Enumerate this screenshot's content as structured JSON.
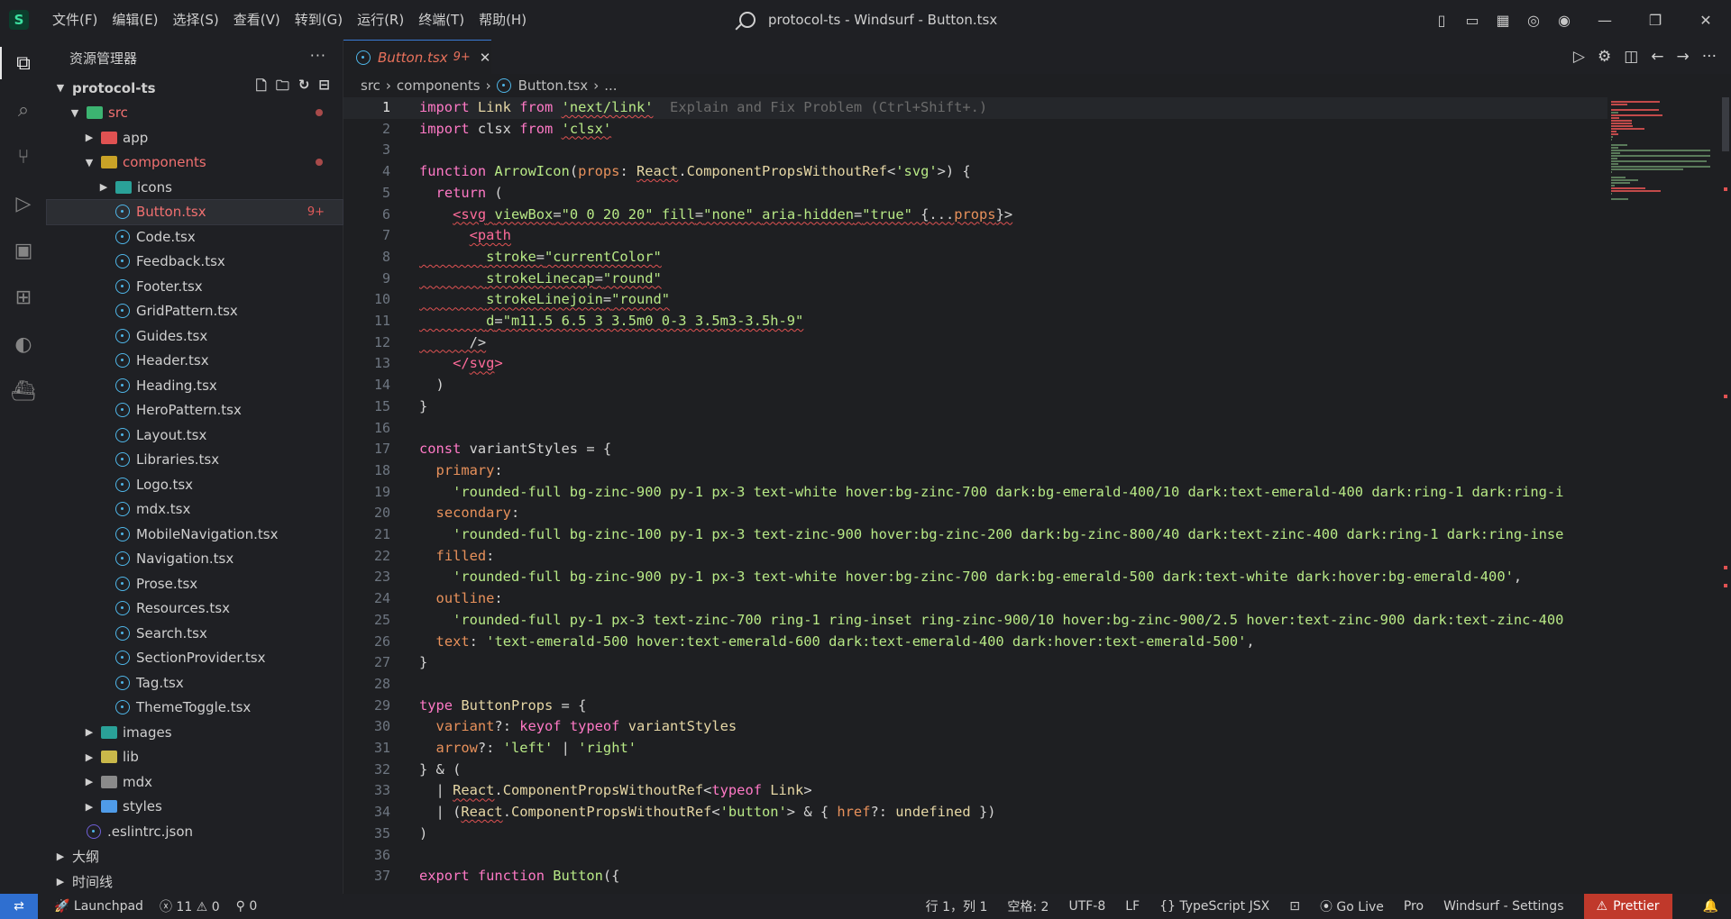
{
  "titlebar": {
    "menus": [
      "文件(F)",
      "编辑(E)",
      "选择(S)",
      "查看(V)",
      "转到(G)",
      "运行(R)",
      "终端(T)",
      "帮助(H)"
    ],
    "window_title": "protocol-ts - Windsurf - Button.tsx"
  },
  "sidebar": {
    "title": "资源管理器",
    "project": "protocol-ts",
    "tree": [
      {
        "label": "src",
        "depth": 1,
        "open": true,
        "kind": "folder-src",
        "dot": true,
        "red": true
      },
      {
        "label": "app",
        "depth": 2,
        "open": false,
        "kind": "folder-app"
      },
      {
        "label": "components",
        "depth": 2,
        "open": true,
        "kind": "folder-comp",
        "dot": true,
        "red": true
      },
      {
        "label": "icons",
        "depth": 3,
        "open": false,
        "kind": "folder-icons"
      },
      {
        "label": "Button.tsx",
        "depth": 3,
        "kind": "react",
        "selected": true,
        "badge": "9+",
        "red": true
      },
      {
        "label": "Code.tsx",
        "depth": 3,
        "kind": "react"
      },
      {
        "label": "Feedback.tsx",
        "depth": 3,
        "kind": "react"
      },
      {
        "label": "Footer.tsx",
        "depth": 3,
        "kind": "react"
      },
      {
        "label": "GridPattern.tsx",
        "depth": 3,
        "kind": "react"
      },
      {
        "label": "Guides.tsx",
        "depth": 3,
        "kind": "react"
      },
      {
        "label": "Header.tsx",
        "depth": 3,
        "kind": "react"
      },
      {
        "label": "Heading.tsx",
        "depth": 3,
        "kind": "react"
      },
      {
        "label": "HeroPattern.tsx",
        "depth": 3,
        "kind": "react"
      },
      {
        "label": "Layout.tsx",
        "depth": 3,
        "kind": "react"
      },
      {
        "label": "Libraries.tsx",
        "depth": 3,
        "kind": "react"
      },
      {
        "label": "Logo.tsx",
        "depth": 3,
        "kind": "react"
      },
      {
        "label": "mdx.tsx",
        "depth": 3,
        "kind": "react"
      },
      {
        "label": "MobileNavigation.tsx",
        "depth": 3,
        "kind": "react"
      },
      {
        "label": "Navigation.tsx",
        "depth": 3,
        "kind": "react"
      },
      {
        "label": "Prose.tsx",
        "depth": 3,
        "kind": "react"
      },
      {
        "label": "Resources.tsx",
        "depth": 3,
        "kind": "react"
      },
      {
        "label": "Search.tsx",
        "depth": 3,
        "kind": "react"
      },
      {
        "label": "SectionProvider.tsx",
        "depth": 3,
        "kind": "react"
      },
      {
        "label": "Tag.tsx",
        "depth": 3,
        "kind": "react"
      },
      {
        "label": "ThemeToggle.tsx",
        "depth": 3,
        "kind": "react"
      },
      {
        "label": "images",
        "depth": 2,
        "open": false,
        "kind": "folder-images"
      },
      {
        "label": "lib",
        "depth": 2,
        "open": false,
        "kind": "folder-lib"
      },
      {
        "label": "mdx",
        "depth": 2,
        "open": false,
        "kind": "folder-plain"
      },
      {
        "label": "styles",
        "depth": 2,
        "open": false,
        "kind": "folder-styles"
      },
      {
        "label": ".eslintrc.json",
        "depth": 1,
        "kind": "eslint"
      }
    ],
    "outline_label": "大纲",
    "timeline_label": "时间线"
  },
  "tab": {
    "label": "Button.tsx",
    "badge": "9+"
  },
  "breadcrumb": [
    "src",
    "components",
    "Button.tsx",
    "..."
  ],
  "code_lines": [
    [
      [
        "kw",
        "import "
      ],
      [
        "ty",
        "Link"
      ],
      [
        "kw",
        " from "
      ],
      [
        "str err",
        "'next/link'"
      ],
      [
        "pl",
        "  "
      ],
      [
        "hint",
        "Explain and Fix Problem (Ctrl+Shift+.)"
      ]
    ],
    [
      [
        "kw",
        "import "
      ],
      [
        "pl",
        "clsx"
      ],
      [
        "kw",
        " from "
      ],
      [
        "str err",
        "'clsx'"
      ]
    ],
    [],
    [
      [
        "kw",
        "function "
      ],
      [
        "fn",
        "ArrowIcon"
      ],
      [
        "pl",
        "("
      ],
      [
        "pr",
        "props"
      ],
      [
        "pl",
        ": "
      ],
      [
        "ty err",
        "React"
      ],
      [
        "pl",
        "."
      ],
      [
        "ty",
        "ComponentPropsWithoutRef"
      ],
      [
        "pl",
        "<"
      ],
      [
        "str",
        "'svg'"
      ],
      [
        "pl",
        ">) {"
      ]
    ],
    [
      [
        "pl",
        "  "
      ],
      [
        "kw",
        "return"
      ],
      [
        "pl",
        " ("
      ]
    ],
    [
      [
        "pl",
        "    "
      ],
      [
        "tag err",
        "<svg"
      ],
      [
        "pl err",
        " "
      ],
      [
        "att err",
        "viewBox"
      ],
      [
        "pl err",
        "="
      ],
      [
        "str err",
        "\"0 0 20 20\""
      ],
      [
        "pl err",
        " "
      ],
      [
        "att err",
        "fill"
      ],
      [
        "pl err",
        "="
      ],
      [
        "str err",
        "\"none\""
      ],
      [
        "pl err",
        " "
      ],
      [
        "att err",
        "aria-hidden"
      ],
      [
        "pl err",
        "="
      ],
      [
        "str err",
        "\"true\""
      ],
      [
        "pl err",
        " {..."
      ],
      [
        "pr err",
        "props"
      ],
      [
        "pl err",
        "}>"
      ]
    ],
    [
      [
        "pl",
        "      "
      ],
      [
        "tag err",
        "<path"
      ]
    ],
    [
      [
        "pl err",
        "        "
      ],
      [
        "att err",
        "stroke"
      ],
      [
        "pl err",
        "="
      ],
      [
        "str err",
        "\"currentColor\""
      ]
    ],
    [
      [
        "pl err",
        "        "
      ],
      [
        "att err",
        "strokeLinecap"
      ],
      [
        "pl err",
        "="
      ],
      [
        "str err",
        "\"round\""
      ]
    ],
    [
      [
        "pl err",
        "        "
      ],
      [
        "att err",
        "strokeLinejoin"
      ],
      [
        "pl err",
        "="
      ],
      [
        "str err",
        "\"round\""
      ]
    ],
    [
      [
        "pl err",
        "        "
      ],
      [
        "att err",
        "d"
      ],
      [
        "pl err",
        "="
      ],
      [
        "str err",
        "\"m11.5 6.5 3 3.5m0 0-3 3.5m3-3.5h-9\""
      ]
    ],
    [
      [
        "pl err",
        "      />"
      ]
    ],
    [
      [
        "pl",
        "    "
      ],
      [
        "tag",
        "</"
      ],
      [
        "tag err",
        "svg"
      ],
      [
        "tag",
        ">"
      ]
    ],
    [
      [
        "pl",
        "  )"
      ]
    ],
    [
      [
        "pl",
        "}"
      ]
    ],
    [],
    [
      [
        "kw",
        "const "
      ],
      [
        "pl",
        "variantStyles = {"
      ]
    ],
    [
      [
        "pl",
        "  "
      ],
      [
        "pr",
        "primary"
      ],
      [
        "pl",
        ":"
      ]
    ],
    [
      [
        "pl",
        "    "
      ],
      [
        "str",
        "'rounded-full bg-zinc-900 py-1 px-3 text-white hover:bg-zinc-700 dark:bg-emerald-400/10 dark:text-emerald-400 dark:ring-1 dark:ring-i"
      ]
    ],
    [
      [
        "pl",
        "  "
      ],
      [
        "pr",
        "secondary"
      ],
      [
        "pl",
        ":"
      ]
    ],
    [
      [
        "pl",
        "    "
      ],
      [
        "str",
        "'rounded-full bg-zinc-100 py-1 px-3 text-zinc-900 hover:bg-zinc-200 dark:bg-zinc-800/40 dark:text-zinc-400 dark:ring-1 dark:ring-inse"
      ]
    ],
    [
      [
        "pl",
        "  "
      ],
      [
        "pr",
        "filled"
      ],
      [
        "pl",
        ":"
      ]
    ],
    [
      [
        "pl",
        "    "
      ],
      [
        "str",
        "'rounded-full bg-zinc-900 py-1 px-3 text-white hover:bg-zinc-700 dark:bg-emerald-500 dark:text-white dark:hover:bg-emerald-400'"
      ],
      [
        "pl",
        ","
      ]
    ],
    [
      [
        "pl",
        "  "
      ],
      [
        "pr",
        "outline"
      ],
      [
        "pl",
        ":"
      ]
    ],
    [
      [
        "pl",
        "    "
      ],
      [
        "str",
        "'rounded-full py-1 px-3 text-zinc-700 ring-1 ring-inset ring-zinc-900/10 hover:bg-zinc-900/2.5 hover:text-zinc-900 dark:text-zinc-400"
      ]
    ],
    [
      [
        "pl",
        "  "
      ],
      [
        "pr",
        "text"
      ],
      [
        "pl",
        ": "
      ],
      [
        "str",
        "'text-emerald-500 hover:text-emerald-600 dark:text-emerald-400 dark:hover:text-emerald-500'"
      ],
      [
        "pl",
        ","
      ]
    ],
    [
      [
        "pl",
        "}"
      ]
    ],
    [],
    [
      [
        "kw",
        "type "
      ],
      [
        "ty",
        "ButtonProps"
      ],
      [
        "pl",
        " = {"
      ]
    ],
    [
      [
        "pl",
        "  "
      ],
      [
        "pr",
        "variant"
      ],
      [
        "pl",
        "?: "
      ],
      [
        "kw",
        "keyof typeof "
      ],
      [
        "ty",
        "variantStyles"
      ]
    ],
    [
      [
        "pl",
        "  "
      ],
      [
        "pr",
        "arrow"
      ],
      [
        "pl",
        "?: "
      ],
      [
        "str",
        "'left'"
      ],
      [
        "pl",
        " | "
      ],
      [
        "str",
        "'right'"
      ]
    ],
    [
      [
        "pl",
        "} & ("
      ]
    ],
    [
      [
        "pl",
        "  | "
      ],
      [
        "ty err",
        "React"
      ],
      [
        "pl",
        "."
      ],
      [
        "ty",
        "ComponentPropsWithoutRef"
      ],
      [
        "pl",
        "<"
      ],
      [
        "kw",
        "typeof "
      ],
      [
        "ty",
        "Link"
      ],
      [
        "pl",
        ">"
      ]
    ],
    [
      [
        "pl",
        "  | ("
      ],
      [
        "ty err",
        "React"
      ],
      [
        "pl",
        "."
      ],
      [
        "ty",
        "ComponentPropsWithoutRef"
      ],
      [
        "pl",
        "<"
      ],
      [
        "str",
        "'button'"
      ],
      [
        "pl",
        "> & { "
      ],
      [
        "pr",
        "href"
      ],
      [
        "pl",
        "?: "
      ],
      [
        "ty",
        "undefined"
      ],
      [
        "pl",
        " })"
      ]
    ],
    [
      [
        "pl",
        ")"
      ]
    ],
    [],
    [
      [
        "kw",
        "export function "
      ],
      [
        "fn",
        "Button"
      ],
      [
        "pl",
        "({"
      ]
    ]
  ],
  "statusbar": {
    "launchpad": "Launchpad",
    "errors": "11",
    "warnings": "0",
    "ports": "0",
    "cursor": "行 1，列 1",
    "spaces": "空格: 2",
    "encoding": "UTF-8",
    "eol": "LF",
    "language": "TypeScript JSX",
    "golive": "Go Live",
    "pro": "Pro",
    "settings": "Windsurf - Settings",
    "prettier": "Prettier"
  },
  "colors": {
    "accent": "#2f6fd0",
    "error": "#e05252",
    "prettier_bg": "#c0392b"
  }
}
